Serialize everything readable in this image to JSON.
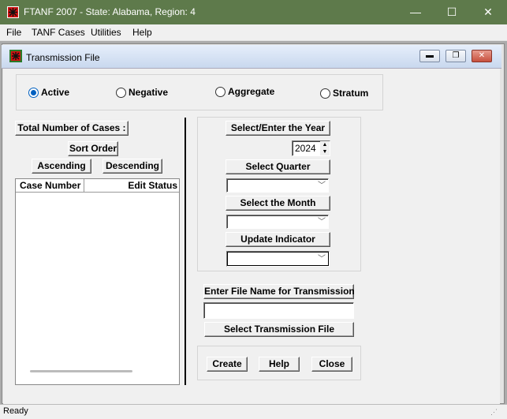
{
  "window": {
    "title": "FTANF 2007 - State: Alabama, Region: 4",
    "controls": {
      "minimize": "—",
      "maximize": "☐",
      "close": "✕"
    }
  },
  "menu": [
    "File",
    "TANF Cases",
    "Utilities",
    "Help"
  ],
  "child_window": {
    "title": "Transmission File",
    "controls": {
      "minimize": "▬",
      "restore": "❐",
      "close": "✕"
    }
  },
  "radios": [
    {
      "label": "Active",
      "selected": true
    },
    {
      "label": "Negative",
      "selected": false
    },
    {
      "label": "Aggregate",
      "selected": false
    },
    {
      "label": "Stratum",
      "selected": false
    }
  ],
  "left_panel": {
    "total_cases_label": "Total Number of Cases :",
    "sort_order_label": "Sort Order",
    "ascending_label": "Ascending",
    "descending_label": "Descending",
    "columns": [
      "Case Number",
      "Edit Status"
    ]
  },
  "right_panel": {
    "year_button": "Select/Enter the Year",
    "year_value": "2024",
    "quarter_button": "Select Quarter",
    "quarter_value": "",
    "month_button": "Select the Month",
    "month_value": "",
    "update_button": "Update Indicator",
    "update_value": "",
    "file_name_button": "Enter File Name for Transmission",
    "file_name_value": "",
    "select_file_button": "Select Transmission File",
    "create_button": "Create",
    "help_button": "Help",
    "close_button": "Close"
  },
  "status": "Ready",
  "colors": {
    "titlebar": "#5e7a4b",
    "radio_accent": "#0060c0",
    "close_button": "#c7503e"
  },
  "icons": [
    "app-icon",
    "child-window-icon",
    "spin-up-icon",
    "spin-down-icon",
    "dropdown-icon"
  ]
}
